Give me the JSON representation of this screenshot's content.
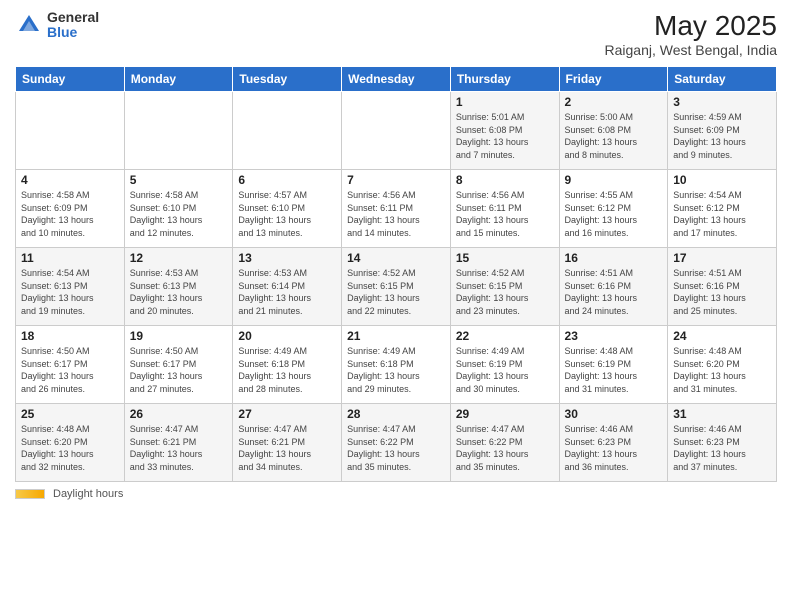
{
  "logo": {
    "general": "General",
    "blue": "Blue"
  },
  "title": "May 2025",
  "location": "Raiganj, West Bengal, India",
  "footer": {
    "daylight_label": "Daylight hours"
  },
  "days_of_week": [
    "Sunday",
    "Monday",
    "Tuesday",
    "Wednesday",
    "Thursday",
    "Friday",
    "Saturday"
  ],
  "weeks": [
    [
      {
        "day": "",
        "info": ""
      },
      {
        "day": "",
        "info": ""
      },
      {
        "day": "",
        "info": ""
      },
      {
        "day": "",
        "info": ""
      },
      {
        "day": "1",
        "info": "Sunrise: 5:01 AM\nSunset: 6:08 PM\nDaylight: 13 hours\nand 7 minutes."
      },
      {
        "day": "2",
        "info": "Sunrise: 5:00 AM\nSunset: 6:08 PM\nDaylight: 13 hours\nand 8 minutes."
      },
      {
        "day": "3",
        "info": "Sunrise: 4:59 AM\nSunset: 6:09 PM\nDaylight: 13 hours\nand 9 minutes."
      }
    ],
    [
      {
        "day": "4",
        "info": "Sunrise: 4:58 AM\nSunset: 6:09 PM\nDaylight: 13 hours\nand 10 minutes."
      },
      {
        "day": "5",
        "info": "Sunrise: 4:58 AM\nSunset: 6:10 PM\nDaylight: 13 hours\nand 12 minutes."
      },
      {
        "day": "6",
        "info": "Sunrise: 4:57 AM\nSunset: 6:10 PM\nDaylight: 13 hours\nand 13 minutes."
      },
      {
        "day": "7",
        "info": "Sunrise: 4:56 AM\nSunset: 6:11 PM\nDaylight: 13 hours\nand 14 minutes."
      },
      {
        "day": "8",
        "info": "Sunrise: 4:56 AM\nSunset: 6:11 PM\nDaylight: 13 hours\nand 15 minutes."
      },
      {
        "day": "9",
        "info": "Sunrise: 4:55 AM\nSunset: 6:12 PM\nDaylight: 13 hours\nand 16 minutes."
      },
      {
        "day": "10",
        "info": "Sunrise: 4:54 AM\nSunset: 6:12 PM\nDaylight: 13 hours\nand 17 minutes."
      }
    ],
    [
      {
        "day": "11",
        "info": "Sunrise: 4:54 AM\nSunset: 6:13 PM\nDaylight: 13 hours\nand 19 minutes."
      },
      {
        "day": "12",
        "info": "Sunrise: 4:53 AM\nSunset: 6:13 PM\nDaylight: 13 hours\nand 20 minutes."
      },
      {
        "day": "13",
        "info": "Sunrise: 4:53 AM\nSunset: 6:14 PM\nDaylight: 13 hours\nand 21 minutes."
      },
      {
        "day": "14",
        "info": "Sunrise: 4:52 AM\nSunset: 6:15 PM\nDaylight: 13 hours\nand 22 minutes."
      },
      {
        "day": "15",
        "info": "Sunrise: 4:52 AM\nSunset: 6:15 PM\nDaylight: 13 hours\nand 23 minutes."
      },
      {
        "day": "16",
        "info": "Sunrise: 4:51 AM\nSunset: 6:16 PM\nDaylight: 13 hours\nand 24 minutes."
      },
      {
        "day": "17",
        "info": "Sunrise: 4:51 AM\nSunset: 6:16 PM\nDaylight: 13 hours\nand 25 minutes."
      }
    ],
    [
      {
        "day": "18",
        "info": "Sunrise: 4:50 AM\nSunset: 6:17 PM\nDaylight: 13 hours\nand 26 minutes."
      },
      {
        "day": "19",
        "info": "Sunrise: 4:50 AM\nSunset: 6:17 PM\nDaylight: 13 hours\nand 27 minutes."
      },
      {
        "day": "20",
        "info": "Sunrise: 4:49 AM\nSunset: 6:18 PM\nDaylight: 13 hours\nand 28 minutes."
      },
      {
        "day": "21",
        "info": "Sunrise: 4:49 AM\nSunset: 6:18 PM\nDaylight: 13 hours\nand 29 minutes."
      },
      {
        "day": "22",
        "info": "Sunrise: 4:49 AM\nSunset: 6:19 PM\nDaylight: 13 hours\nand 30 minutes."
      },
      {
        "day": "23",
        "info": "Sunrise: 4:48 AM\nSunset: 6:19 PM\nDaylight: 13 hours\nand 31 minutes."
      },
      {
        "day": "24",
        "info": "Sunrise: 4:48 AM\nSunset: 6:20 PM\nDaylight: 13 hours\nand 31 minutes."
      }
    ],
    [
      {
        "day": "25",
        "info": "Sunrise: 4:48 AM\nSunset: 6:20 PM\nDaylight: 13 hours\nand 32 minutes."
      },
      {
        "day": "26",
        "info": "Sunrise: 4:47 AM\nSunset: 6:21 PM\nDaylight: 13 hours\nand 33 minutes."
      },
      {
        "day": "27",
        "info": "Sunrise: 4:47 AM\nSunset: 6:21 PM\nDaylight: 13 hours\nand 34 minutes."
      },
      {
        "day": "28",
        "info": "Sunrise: 4:47 AM\nSunset: 6:22 PM\nDaylight: 13 hours\nand 35 minutes."
      },
      {
        "day": "29",
        "info": "Sunrise: 4:47 AM\nSunset: 6:22 PM\nDaylight: 13 hours\nand 35 minutes."
      },
      {
        "day": "30",
        "info": "Sunrise: 4:46 AM\nSunset: 6:23 PM\nDaylight: 13 hours\nand 36 minutes."
      },
      {
        "day": "31",
        "info": "Sunrise: 4:46 AM\nSunset: 6:23 PM\nDaylight: 13 hours\nand 37 minutes."
      }
    ]
  ]
}
